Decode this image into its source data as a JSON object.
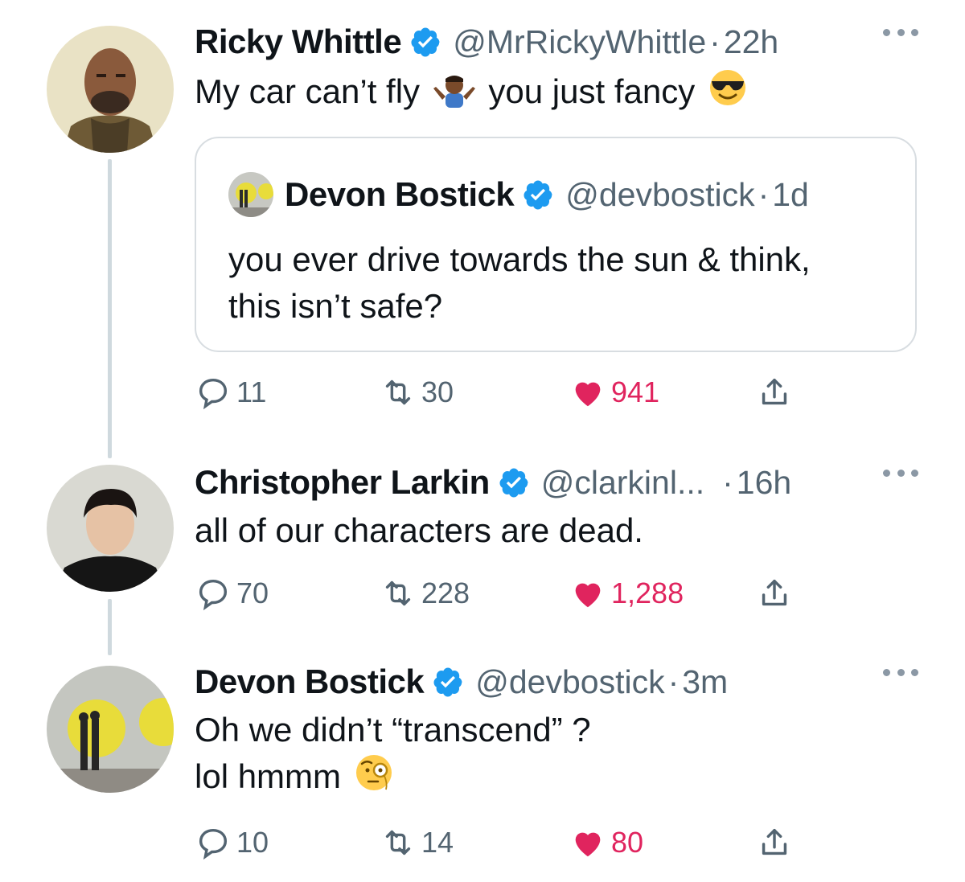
{
  "tweets": [
    {
      "name": "Ricky Whittle",
      "handle": "@MrRickyWhittle",
      "time": "22h",
      "text_before": "My car can’t fly",
      "text_after": "you just fancy",
      "emoji_1": "person-shrugging-emoji",
      "emoji_2": "smiling-face-with-sunglasses-emoji",
      "quote": {
        "name": "Devon Bostick",
        "handle": "@devbostick",
        "time": "1d",
        "line1": "you ever drive towards the sun & think,",
        "line2": "this isn’t safe?"
      },
      "stats": {
        "replies": "11",
        "retweets": "30",
        "likes": "941"
      }
    },
    {
      "name": "Christopher Larkin",
      "handle": "@clarkinl...",
      "time": "16h",
      "text": "all of our characters are dead.",
      "stats": {
        "replies": "70",
        "retweets": "228",
        "likes": "1,288"
      }
    },
    {
      "name": "Devon Bostick",
      "handle": "@devbostick",
      "time": "3m",
      "line1": "Oh we didn’t “transcend” ?",
      "line2": "lol hmmm",
      "emoji": "face-with-monocle-emoji",
      "stats": {
        "replies": "10",
        "retweets": "14",
        "likes": "80"
      }
    }
  ],
  "separator": "·",
  "colors": {
    "like": "#e0245e",
    "verified": "#1d9bf0",
    "secondary": "#536471",
    "thread": "#cfd9de"
  }
}
